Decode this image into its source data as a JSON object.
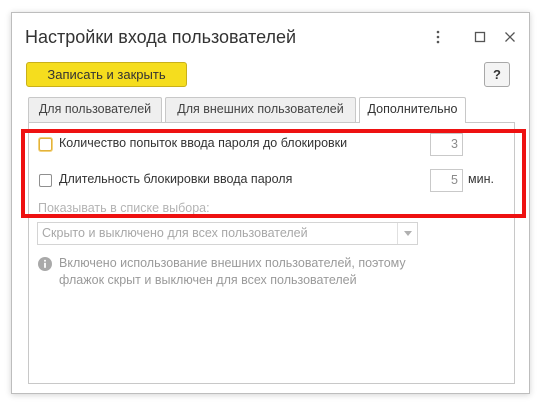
{
  "window": {
    "title": "Настройки входа пользователей"
  },
  "toolbar": {
    "save_close_label": "Записать и закрыть",
    "help_label": "?"
  },
  "tabs": [
    {
      "label": "Для пользователей",
      "active": false
    },
    {
      "label": "Для внешних пользователей",
      "active": false
    },
    {
      "label": "Дополнительно",
      "active": true
    }
  ],
  "settings": {
    "attempts": {
      "label": "Количество попыток ввода пароля до блокировки",
      "checked": false,
      "value": "3"
    },
    "lock_duration": {
      "label": "Длительность блокировки ввода пароля",
      "checked": false,
      "value": "5",
      "unit": "мин."
    },
    "show_in_list_label": "Показывать в списке выбора:",
    "show_in_list_value": "Скрыто и выключено для всех пользователей",
    "info_text": "Включено использование внешних пользователей, поэтому флажок скрыт и выключен для всех пользователей"
  },
  "colors": {
    "accent_yellow": "#f5dd1e",
    "highlight_red": "#ee1111",
    "focus_orange": "#e2b23b"
  },
  "icons": [
    "more-vertical-icon",
    "maximize-icon",
    "close-icon",
    "chevron-down-icon",
    "info-icon"
  ]
}
